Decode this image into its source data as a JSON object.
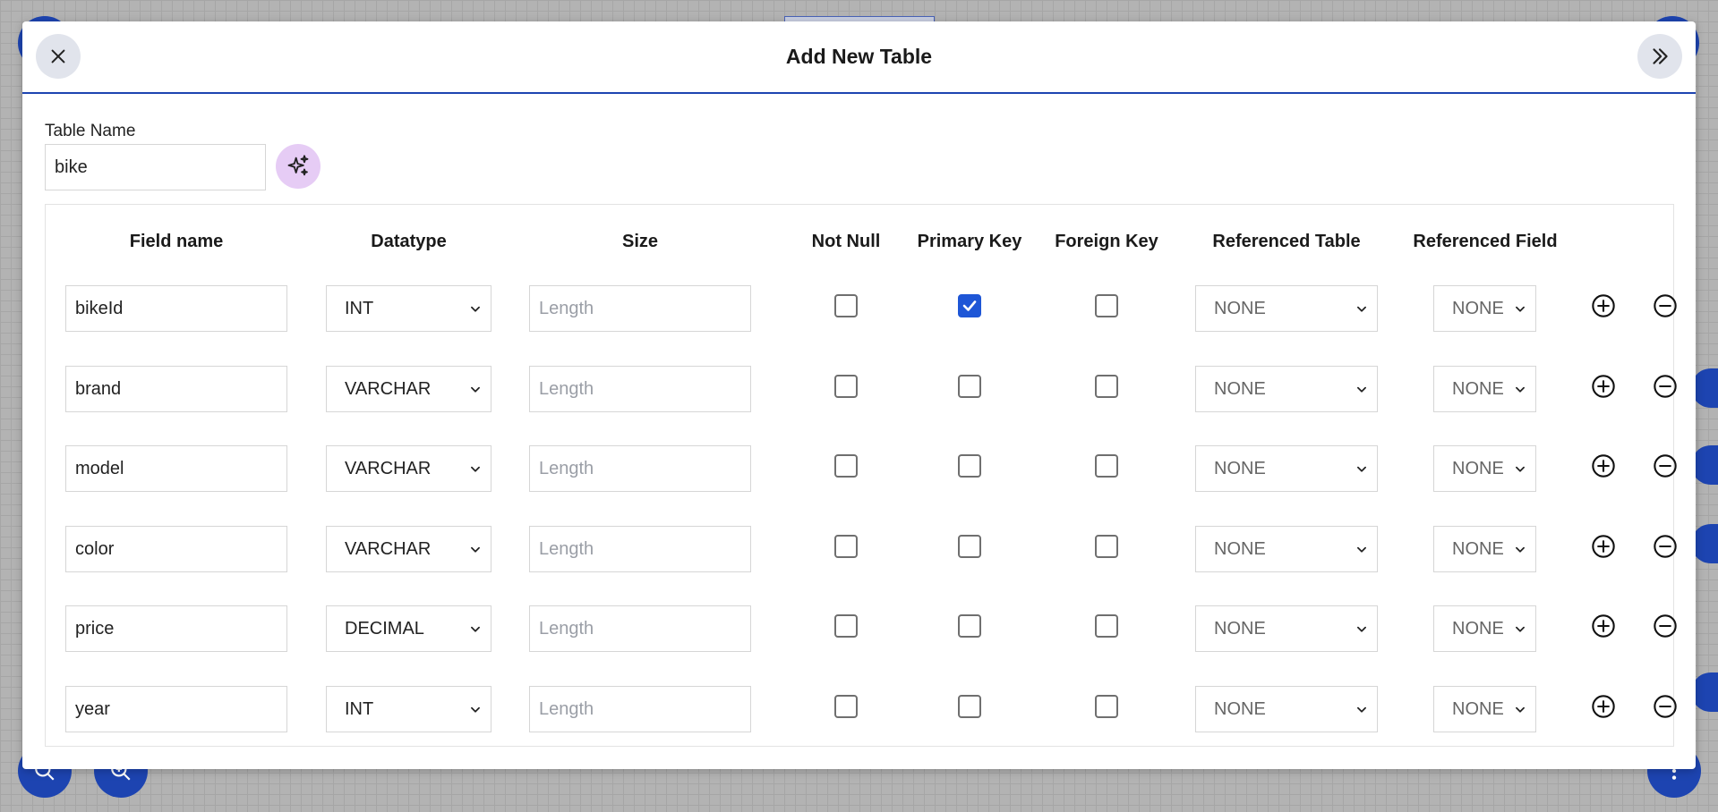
{
  "modal": {
    "title": "Add New Table"
  },
  "table_name": {
    "label": "Table Name",
    "value": "bike"
  },
  "columns": [
    "Field name",
    "Datatype",
    "Size",
    "Not Null",
    "Primary Key",
    "Foreign Key",
    "Referenced Table",
    "Referenced Field"
  ],
  "size_placeholder": "Length",
  "rows": [
    {
      "field": "bikeId",
      "datatype": "INT",
      "not_null": false,
      "primary_key": true,
      "foreign_key": false,
      "ref_table": "NONE",
      "ref_field": "NONE"
    },
    {
      "field": "brand",
      "datatype": "VARCHAR",
      "not_null": false,
      "primary_key": false,
      "foreign_key": false,
      "ref_table": "NONE",
      "ref_field": "NONE"
    },
    {
      "field": "model",
      "datatype": "VARCHAR",
      "not_null": false,
      "primary_key": false,
      "foreign_key": false,
      "ref_table": "NONE",
      "ref_field": "NONE"
    },
    {
      "field": "color",
      "datatype": "VARCHAR",
      "not_null": false,
      "primary_key": false,
      "foreign_key": false,
      "ref_table": "NONE",
      "ref_field": "NONE"
    },
    {
      "field": "price",
      "datatype": "DECIMAL",
      "not_null": false,
      "primary_key": false,
      "foreign_key": false,
      "ref_table": "NONE",
      "ref_field": "NONE"
    },
    {
      "field": "year",
      "datatype": "INT",
      "not_null": false,
      "primary_key": false,
      "foreign_key": false,
      "ref_table": "NONE",
      "ref_field": "NONE"
    }
  ],
  "icons": {
    "close": "close-icon",
    "expand": "double-chevron-right-icon",
    "ai": "sparkles-icon",
    "add_row": "plus-circle-icon",
    "remove_row": "minus-circle-icon",
    "search": "search-icon",
    "zoom": "zoom-in-icon",
    "more": "more-vertical-icon"
  },
  "colors": {
    "accent": "#1d44b1",
    "checkbox_checked": "#1e56d6",
    "ai_button": "#e6ccf5",
    "header_button": "#e1e4ec"
  }
}
